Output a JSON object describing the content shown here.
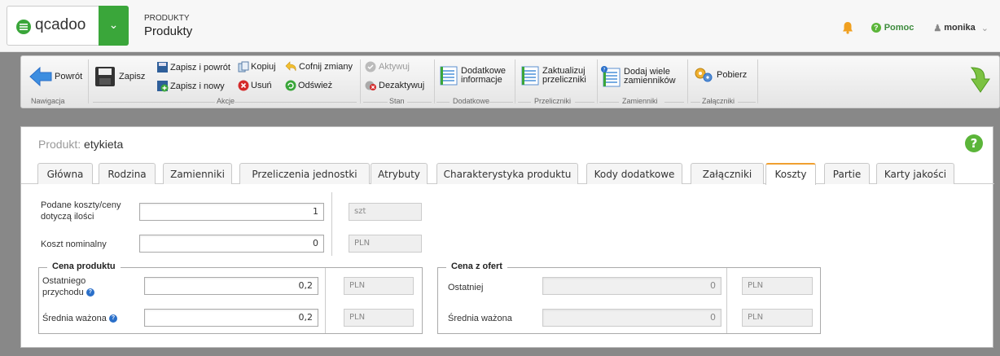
{
  "header": {
    "logo_text": "qcadoo",
    "section": "PRODUKTY",
    "page": "Produkty",
    "help": "Pomoc",
    "user": "monika"
  },
  "toolbar": {
    "back": "Powrót",
    "save": "Zapisz",
    "save_and_back": "Zapisz i powrót",
    "save_and_new": "Zapisz i nowy",
    "copy": "Kopiuj",
    "delete": "Usuń",
    "undo": "Cofnij zmiany",
    "refresh": "Odśwież",
    "activate": "Aktywuj",
    "deactivate": "Dezaktywuj",
    "additional_info": "Dodatkowe informacje",
    "update_converters": "Zaktualizuj przeliczniki",
    "add_substitutes": "Dodaj wiele zamienników",
    "download": "Pobierz",
    "groups": {
      "nav": "Nawigacja",
      "actions": "Akcje",
      "state": "Stan",
      "additional": "Dodatkowe",
      "converters": "Przeliczniki",
      "substitutes": "Zamienniki",
      "attachments": "Załączniki"
    }
  },
  "panel": {
    "title_label": "Produkt:",
    "title_value": "etykieta"
  },
  "tabs": [
    "Główna",
    "Rodzina",
    "Zamienniki",
    "Przeliczenia jednostki",
    "Atrybuty",
    "Charakterystyka produktu",
    "Kody dodatkowe",
    "Załączniki",
    "Koszty",
    "Partie",
    "Karty jakości"
  ],
  "form": {
    "qty_label": "Podane koszty/ceny dotyczą ilości",
    "qty_value": "1",
    "qty_unit": "szt",
    "nominal_label": "Koszt nominalny",
    "nominal_value": "0",
    "nominal_unit": "PLN",
    "product_price": {
      "legend": "Cena produktu",
      "last_label": "Ostatniego przychodu",
      "last_value": "0,2",
      "last_unit": "PLN",
      "avg_label": "Średnia ważona",
      "avg_value": "0,2",
      "avg_unit": "PLN"
    },
    "offer_price": {
      "legend": "Cena z ofert",
      "last_label": "Ostatniej",
      "last_value": "0",
      "last_unit": "PLN",
      "avg_label": "Średnia ważona",
      "avg_value": "0",
      "avg_unit": "PLN"
    }
  }
}
